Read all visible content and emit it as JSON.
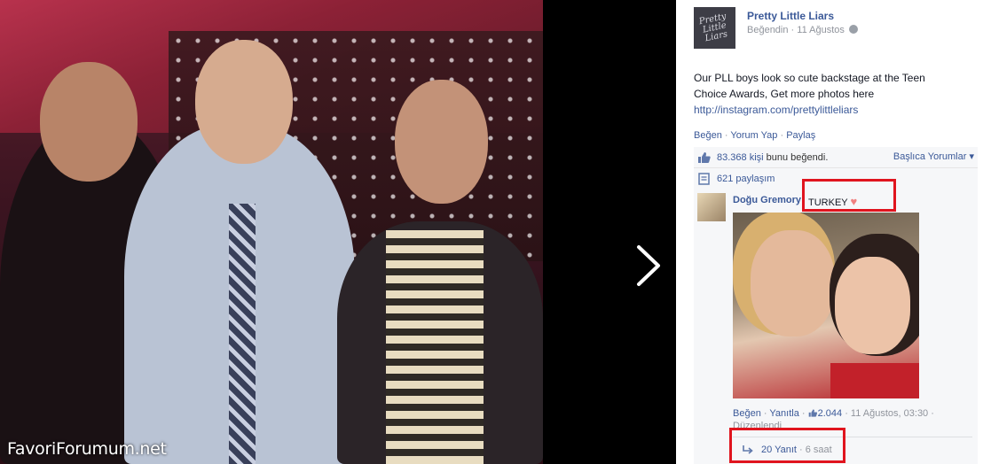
{
  "photo": {
    "watermark": "FavoriForumum.net"
  },
  "post": {
    "page_name": "Pretty Little Liars",
    "avatar_text": "Pretty Little Liars",
    "meta": "Beğendin · 11 Ağustos",
    "text_line1": "Our PLL boys look so cute backstage at the Teen Choice Awards, Get more photos here",
    "link": "http://instagram.com/prettylittleliars",
    "actions": {
      "like": "Beğen",
      "comment": "Yorum Yap",
      "share": "Paylaş"
    }
  },
  "ufi": {
    "likes_count": "83.368 kişi",
    "likes_suffix": "bunu beğendi.",
    "sort_label": "Başlıca Yorumlar",
    "shares": "621 paylaşım"
  },
  "comment": {
    "author": "Doğu Gremory",
    "text": "TURKEY",
    "heart": "♥",
    "like": "Beğen",
    "reply": "Yanıtla",
    "like_count": "2.044",
    "timestamp": "11 Ağustos, 03:30",
    "edited": "Düzenlendi",
    "replies_label": "20 Yanıt",
    "replies_time": "6 saat"
  },
  "colors": {
    "link": "#3b5998",
    "highlight": "#e0141e"
  }
}
